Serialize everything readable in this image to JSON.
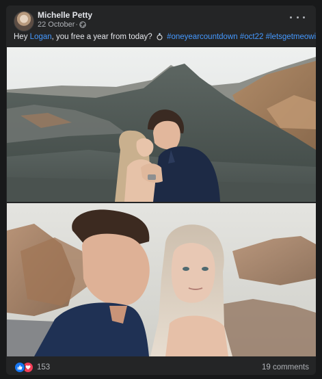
{
  "post": {
    "author": "Michelle Petty",
    "date": "22 October",
    "separator": "·",
    "privacy_icon": "globe-icon",
    "caption": {
      "before": "Hey ",
      "mention": "Logan",
      "after": ", you free a year from today?",
      "emoji_icon": "ring-icon",
      "hashtags": [
        "#oneyearcountdown",
        "#oct22",
        "#letsgetmeowied"
      ]
    }
  },
  "photos": [
    {
      "name": "couple-mountain-photo"
    },
    {
      "name": "couple-rocks-photo"
    }
  ],
  "footer": {
    "reaction_icons": [
      "like-icon",
      "love-icon"
    ],
    "reaction_count": "153",
    "comments_label": "19 comments"
  },
  "colors": {
    "card": "#242526",
    "background": "#18191a",
    "link": "#4599ff",
    "like": "#1877f2",
    "love": "#f33e58"
  }
}
